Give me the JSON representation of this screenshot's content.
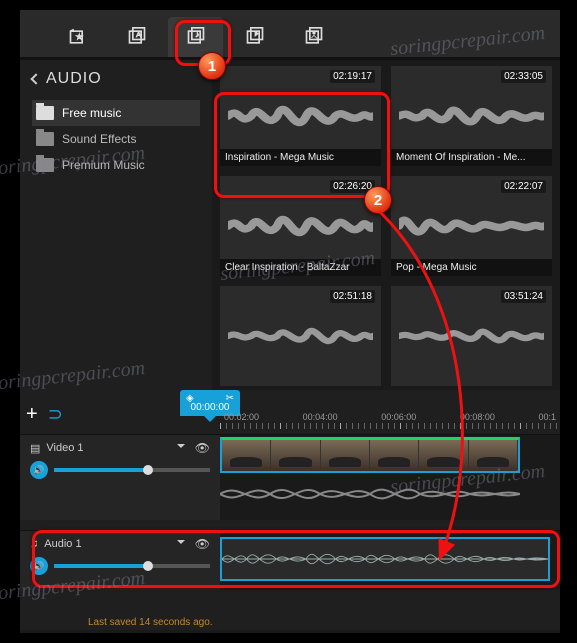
{
  "tabs": [
    {
      "name": "pages-tab"
    },
    {
      "name": "text-tab"
    },
    {
      "name": "audio-tab"
    },
    {
      "name": "video-tab"
    },
    {
      "name": "image-tab"
    }
  ],
  "sidebar": {
    "title": "AUDIO",
    "items": [
      {
        "label": "Free music",
        "active": true
      },
      {
        "label": "Sound Effects"
      },
      {
        "label": "Premium Music"
      }
    ]
  },
  "clips": [
    {
      "duration": "02:19:17",
      "title": "Inspiration - Mega Music"
    },
    {
      "duration": "02:33:05",
      "title": "Moment Of Inspiration - Me..."
    },
    {
      "duration": "02:26:20",
      "title": "Clear Inspiration - BaltaZzar"
    },
    {
      "duration": "02:22:07",
      "title": "Pop - Mega Music"
    },
    {
      "duration": "02:51:18",
      "title": ""
    },
    {
      "duration": "03:51:24",
      "title": ""
    }
  ],
  "timeline": {
    "playhead": "00:00:00",
    "ruler": [
      "00:02:00",
      "00:04:00",
      "00:06:00",
      "00:08:00",
      "00:1"
    ],
    "tracks": {
      "video": {
        "label": "Video 1",
        "volume": 60
      },
      "audio": {
        "label": "Audio 1",
        "volume": 60
      }
    },
    "saved_msg": "Last saved 14 seconds ago."
  },
  "annotations": {
    "n1": "1",
    "n2": "2"
  },
  "watermark": "soringpcrepair.com"
}
